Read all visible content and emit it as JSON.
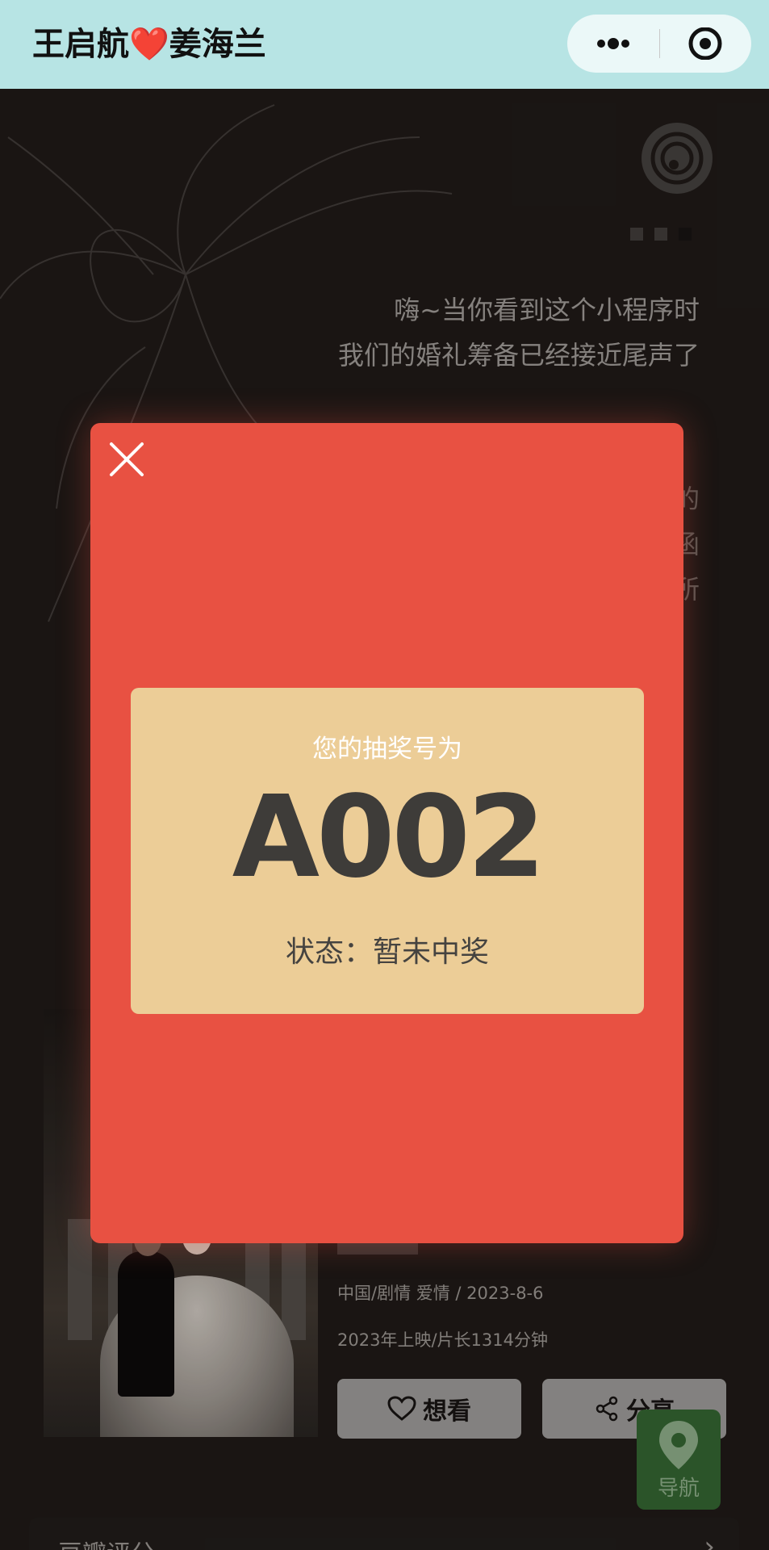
{
  "top_bar": {
    "title": "王启航❤️姜海兰",
    "more_icon": "more-dots-icon",
    "close_icon": "target-close-icon"
  },
  "page": {
    "intro_lines": [
      "嗨~当你看到这个小程序时",
      "我们的婚礼筹备已经接近尾声了"
    ],
    "side_chars": [
      "的",
      "函",
      "所"
    ],
    "meta": {
      "genre_date": "中国/剧情 爱情 / 2023-8-6",
      "release_length": "2023年上映/片长1314分钟"
    },
    "buttons": {
      "want_to_see": "想看",
      "share": "分享"
    },
    "nav_fab": "导航",
    "reviews_label": "豆瓣评分",
    "reviews_arrow": "›"
  },
  "modal": {
    "ticket_label": "您的抽奖号为",
    "ticket_number": "A002",
    "status": "状态：暂未中奖"
  },
  "colors": {
    "top_bar_bg": "#b7e4e4",
    "page_bg": "#1c1715",
    "modal_bg": "#e85142",
    "ticket_bg": "#eccd97",
    "nav_fab_bg": "#2e5a2c"
  }
}
